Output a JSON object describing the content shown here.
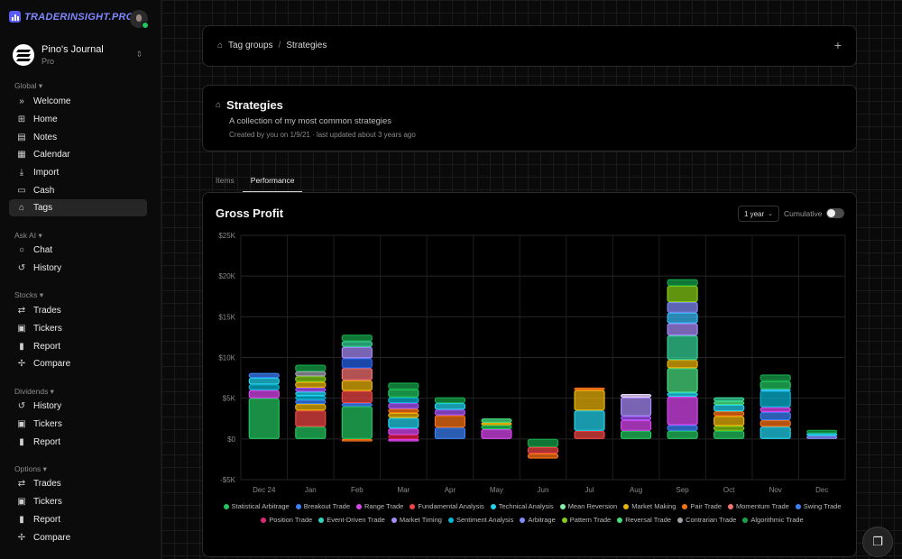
{
  "brand": {
    "name": "TRADERINSIGHT.PRO"
  },
  "journal": {
    "name": "Pino's Journal",
    "plan": "Pro"
  },
  "sidebar": {
    "sections": [
      {
        "label": "Global ▾",
        "items": [
          {
            "label": "Welcome",
            "icon": "»"
          },
          {
            "label": "Home",
            "icon": "⊞"
          },
          {
            "label": "Notes",
            "icon": "▤"
          },
          {
            "label": "Calendar",
            "icon": "▦"
          },
          {
            "label": "Import",
            "icon": "⤓"
          },
          {
            "label": "Cash",
            "icon": "▭"
          },
          {
            "label": "Tags",
            "icon": "⌂",
            "active": true
          }
        ]
      },
      {
        "label": "Ask AI ▾",
        "items": [
          {
            "label": "Chat",
            "icon": "○"
          },
          {
            "label": "History",
            "icon": "↺"
          }
        ]
      },
      {
        "label": "Stocks ▾",
        "items": [
          {
            "label": "Trades",
            "icon": "⇄"
          },
          {
            "label": "Tickers",
            "icon": "▣"
          },
          {
            "label": "Report",
            "icon": "▮"
          },
          {
            "label": "Compare",
            "icon": "✢"
          }
        ]
      },
      {
        "label": "Dividends ▾",
        "items": [
          {
            "label": "History",
            "icon": "↺"
          },
          {
            "label": "Tickers",
            "icon": "▣"
          },
          {
            "label": "Report",
            "icon": "▮"
          }
        ]
      },
      {
        "label": "Options ▾",
        "items": [
          {
            "label": "Trades",
            "icon": "⇄"
          },
          {
            "label": "Tickers",
            "icon": "▣"
          },
          {
            "label": "Report",
            "icon": "▮"
          },
          {
            "label": "Compare",
            "icon": "✢"
          }
        ]
      }
    ]
  },
  "breadcrumb": {
    "parent": "Tag groups",
    "separator": "/",
    "current": "Strategies"
  },
  "group": {
    "title": "Strategies",
    "description": "A collection of my most common strategies",
    "meta": "Created by you on 1/9/21 · last updated about 3 years ago"
  },
  "tabs": [
    {
      "label": "Items",
      "active": false
    },
    {
      "label": "Performance",
      "active": true
    }
  ],
  "chart_card": {
    "title": "Gross Profit",
    "range": "1 year",
    "cumulative_label": "Cumulative",
    "cumulative_on": false
  },
  "chart_data": {
    "type": "bar",
    "stacked": true,
    "title": "Gross Profit",
    "categories": [
      "Dec 24",
      "Jan",
      "Feb",
      "Mar",
      "Apr",
      "May",
      "Jun",
      "Jul",
      "Aug",
      "Sep",
      "Oct",
      "Nov",
      "Dec"
    ],
    "y_ticks": [
      "-$5K",
      "$0",
      "$5K",
      "$10K",
      "$15K",
      "$20K",
      "$25K"
    ],
    "ylim": [
      -5000,
      25000
    ],
    "grid": true,
    "legend_position": "bottom",
    "bars": [
      [
        {
          "c": "#22c55e",
          "v": 5000
        },
        {
          "c": "#d946ef",
          "v": 1000
        },
        {
          "c": "#06b6d4",
          "v": 700
        },
        {
          "c": "#22d3ee",
          "v": 800
        },
        {
          "c": "#3b82f6",
          "v": 600
        }
      ],
      [
        {
          "c": "#22c55e",
          "v": 1500
        },
        {
          "c": "#ef4444",
          "v": 2000
        },
        {
          "c": "#eab308",
          "v": 800
        },
        {
          "c": "#3b82f6",
          "v": 500
        },
        {
          "c": "#06b6d4",
          "v": 500
        },
        {
          "c": "#22d3ee",
          "v": 500
        },
        {
          "c": "#a855f7",
          "v": 500
        },
        {
          "c": "#eab308",
          "v": 700
        },
        {
          "c": "#84cc16",
          "v": 700
        },
        {
          "c": "#a1a1aa",
          "v": 600
        },
        {
          "c": "#16a34a",
          "v": 800
        }
      ],
      [
        {
          "c": "#f97316",
          "v": -300
        },
        {
          "c": "#22c55e",
          "v": 4000
        },
        {
          "c": "#3b82f6",
          "v": 400
        },
        {
          "c": "#ef4444",
          "v": 1500
        },
        {
          "c": "#eab308",
          "v": 1300
        },
        {
          "c": "#f87171",
          "v": 1500
        },
        {
          "c": "#2563eb",
          "v": 1200
        },
        {
          "c": "#a78bfa",
          "v": 1400
        },
        {
          "c": "#34d399",
          "v": 700
        },
        {
          "c": "#16a34a",
          "v": 800
        }
      ],
      [
        {
          "c": "#d946ef",
          "v": -300
        },
        {
          "c": "#e11d48",
          "v": 500
        },
        {
          "c": "#d946ef",
          "v": 800
        },
        {
          "c": "#22d3ee",
          "v": 1300
        },
        {
          "c": "#eab308",
          "v": 600
        },
        {
          "c": "#f97316",
          "v": 500
        },
        {
          "c": "#a855f7",
          "v": 700
        },
        {
          "c": "#06b6d4",
          "v": 700
        },
        {
          "c": "#22c55e",
          "v": 1000
        },
        {
          "c": "#16a34a",
          "v": 800
        }
      ],
      [
        {
          "c": "#3b82f6",
          "v": 1400
        },
        {
          "c": "#f97316",
          "v": 1500
        },
        {
          "c": "#a855f7",
          "v": 700
        },
        {
          "c": "#22d3ee",
          "v": 800
        },
        {
          "c": "#16a34a",
          "v": 700
        }
      ],
      [
        {
          "c": "#d946ef",
          "v": 1200
        },
        {
          "c": "#22c55e",
          "v": 500
        },
        {
          "c": "#eab308",
          "v": 300
        },
        {
          "c": "#4ade80",
          "v": 500
        }
      ],
      [
        {
          "c": "#16a34a",
          "v": -1000
        },
        {
          "c": "#ef4444",
          "v": -800
        },
        {
          "c": "#f97316",
          "v": -600
        }
      ],
      [
        {
          "c": "#ef4444",
          "v": 1000
        },
        {
          "c": "#22d3ee",
          "v": 2500
        },
        {
          "c": "#eab308",
          "v": 2500
        },
        {
          "c": "#f97316",
          "v": 300
        }
      ],
      [
        {
          "c": "#22c55e",
          "v": 1000
        },
        {
          "c": "#d946ef",
          "v": 1300
        },
        {
          "c": "#a855f7",
          "v": 500
        },
        {
          "c": "#a78bfa",
          "v": 2300
        },
        {
          "c": "#e9d5ff",
          "v": 400
        }
      ],
      [
        {
          "c": "#22c55e",
          "v": 1000
        },
        {
          "c": "#3b82f6",
          "v": 700
        },
        {
          "c": "#d946ef",
          "v": 3500
        },
        {
          "c": "#22d3ee",
          "v": 500
        },
        {
          "c": "#4ade80",
          "v": 3000
        },
        {
          "c": "#eab308",
          "v": 1000
        },
        {
          "c": "#34d399",
          "v": 3000
        },
        {
          "c": "#a78bfa",
          "v": 1500
        },
        {
          "c": "#38bdf8",
          "v": 1300
        },
        {
          "c": "#818cf8",
          "v": 1300
        },
        {
          "c": "#84cc16",
          "v": 2000
        },
        {
          "c": "#16a34a",
          "v": 800
        }
      ],
      [
        {
          "c": "#22c55e",
          "v": 1000
        },
        {
          "c": "#84cc16",
          "v": 600
        },
        {
          "c": "#eab308",
          "v": 1200
        },
        {
          "c": "#f97316",
          "v": 600
        },
        {
          "c": "#22d3ee",
          "v": 800
        },
        {
          "c": "#4ade80",
          "v": 400
        },
        {
          "c": "#34d399",
          "v": 500
        }
      ],
      [
        {
          "c": "#22d3ee",
          "v": 1500
        },
        {
          "c": "#f97316",
          "v": 800
        },
        {
          "c": "#3b82f6",
          "v": 1000
        },
        {
          "c": "#d946ef",
          "v": 600
        },
        {
          "c": "#06b6d4",
          "v": 2000
        },
        {
          "c": "#38bdf8",
          "v": 200
        },
        {
          "c": "#22c55e",
          "v": 1000
        },
        {
          "c": "#16a34a",
          "v": 800
        }
      ],
      [
        {
          "c": "#818cf8",
          "v": 400
        },
        {
          "c": "#22d3ee",
          "v": 300
        },
        {
          "c": "#16a34a",
          "v": 400
        }
      ]
    ],
    "legend": [
      {
        "name": "Statistical Arbitrage",
        "color": "#22c55e"
      },
      {
        "name": "Breakout Trade",
        "color": "#3b82f6"
      },
      {
        "name": "Range Trade",
        "color": "#d946ef"
      },
      {
        "name": "Fundamental Analysis",
        "color": "#ef4444"
      },
      {
        "name": "Technical Analysis",
        "color": "#22d3ee"
      },
      {
        "name": "Mean Reversion",
        "color": "#86efac"
      },
      {
        "name": "Market Making",
        "color": "#eab308"
      },
      {
        "name": "Pair Trade",
        "color": "#f97316"
      },
      {
        "name": "Momentum Trade",
        "color": "#f87171"
      },
      {
        "name": "Swing Trade",
        "color": "#3b82f6"
      },
      {
        "name": "Position Trade",
        "color": "#db2777"
      },
      {
        "name": "Event-Driven Trade",
        "color": "#2dd4bf"
      },
      {
        "name": "Market Timing",
        "color": "#a78bfa"
      },
      {
        "name": "Sentiment Analysis",
        "color": "#06b6d4"
      },
      {
        "name": "Arbitrage",
        "color": "#818cf8"
      },
      {
        "name": "Pattern Trade",
        "color": "#84cc16"
      },
      {
        "name": "Reversal Trade",
        "color": "#4ade80"
      },
      {
        "name": "Contrarian Trade",
        "color": "#a1a1aa"
      },
      {
        "name": "Algorithmic Trade",
        "color": "#16a34a"
      }
    ]
  }
}
